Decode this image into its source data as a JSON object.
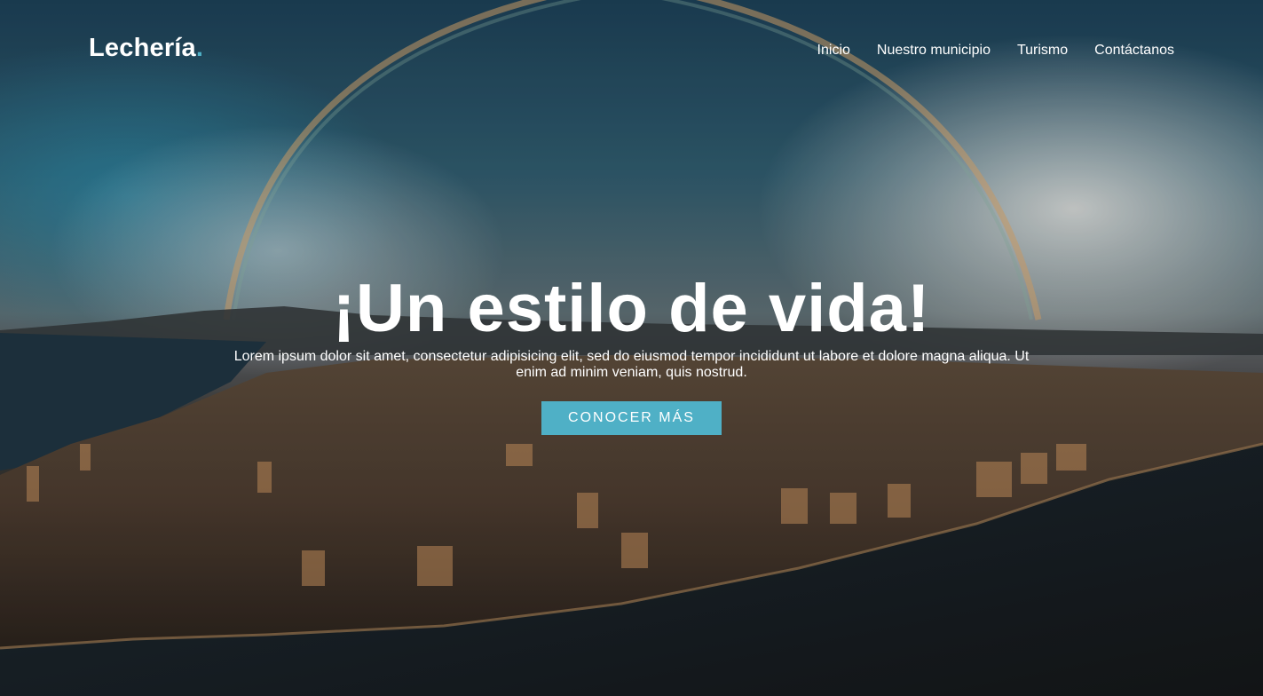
{
  "header": {
    "logo_text": "Lechería",
    "logo_dot": ".",
    "nav": [
      {
        "label": "Inicio"
      },
      {
        "label": "Nuestro municipio"
      },
      {
        "label": "Turismo"
      },
      {
        "label": "Contáctanos"
      }
    ]
  },
  "hero": {
    "title": "¡Un estilo de vida!",
    "subtitle": "Lorem ipsum dolor sit amet, consectetur adipisicing elit, sed do eiusmod tempor incididunt ut labore et dolore magna aliqua. Ut enim ad minim veniam, quis nostrud.",
    "cta_label": "CONOCER MÁS",
    "background_image": "aerial-coastal-city-with-rainbow"
  },
  "colors": {
    "accent": "#4fb0c6",
    "text": "#ffffff"
  }
}
